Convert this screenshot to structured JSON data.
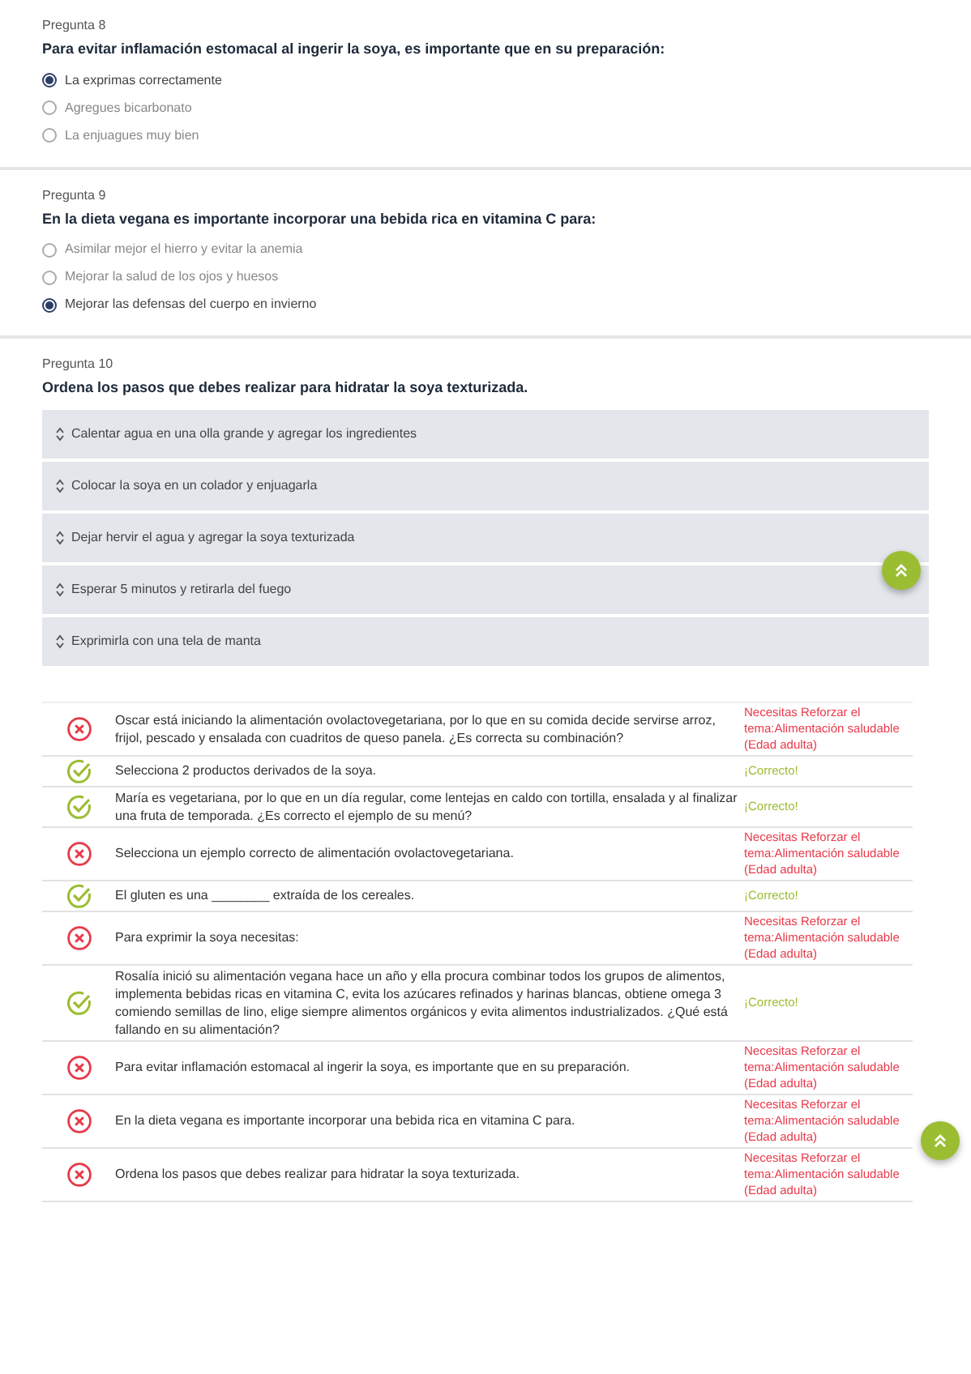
{
  "questions": [
    {
      "label": "Pregunta 8",
      "prompt": "Para evitar inflamación estomacal al ingerir la soya, es importante que en su preparación:",
      "kind": "radio",
      "options": [
        {
          "text": "La exprimas correctamente",
          "selected": true
        },
        {
          "text": "Agregues bicarbonato",
          "selected": false
        },
        {
          "text": "La enjuagues muy bien",
          "selected": false
        }
      ]
    },
    {
      "label": "Pregunta 9",
      "prompt": "En la dieta vegana es importante incorporar una bebida rica en vitamina C para:",
      "kind": "radio",
      "options": [
        {
          "text": "Asimilar mejor el hierro y evitar la anemia",
          "selected": false
        },
        {
          "text": "Mejorar la salud de los ojos y huesos",
          "selected": false
        },
        {
          "text": "Mejorar las defensas del cuerpo en invierno",
          "selected": true
        }
      ]
    },
    {
      "label": "Pregunta 10",
      "prompt": "Ordena los pasos que debes realizar para hidratar la soya texturizada.",
      "kind": "order",
      "options": [
        {
          "text": "Calentar agua en una olla grande y agregar los ingredientes"
        },
        {
          "text": "Colocar la soya en un colador y enjuagarla"
        },
        {
          "text": "Dejar hervir el agua y agregar la soya texturizada"
        },
        {
          "text": "Esperar 5 minutos y retirarla del fuego"
        },
        {
          "text": "Exprimirla con una tela de manta"
        }
      ]
    }
  ],
  "results": [
    {
      "correct": false,
      "question": "Oscar está iniciando la alimentación ovolactovegetariana, por lo que en su comida decide servirse arroz, frijol, pescado y ensalada con cuadritos de queso panela. ¿Es correcta su combinación?",
      "feedback": "Necesitas Reforzar el tema:Alimentación saludable (Edad adulta)"
    },
    {
      "correct": true,
      "question": "Selecciona 2 productos derivados de la soya.",
      "feedback": "¡Correcto!"
    },
    {
      "correct": true,
      "question": "María es vegetariana, por lo que en un día regular, come lentejas en caldo con tortilla, ensalada y al finalizar una fruta de temporada. ¿Es correcto el ejemplo de su menú?",
      "feedback": "¡Correcto!"
    },
    {
      "correct": false,
      "question": "Selecciona un ejemplo correcto de alimentación ovolactovegetariana.",
      "feedback": "Necesitas Reforzar el tema:Alimentación saludable (Edad adulta)"
    },
    {
      "correct": true,
      "question": "El gluten es una ________ extraída de los cereales.",
      "feedback": "¡Correcto!"
    },
    {
      "correct": false,
      "question": "Para exprimir la soya necesitas:",
      "feedback": "Necesitas Reforzar el tema:Alimentación saludable (Edad adulta)"
    },
    {
      "correct": true,
      "question": "Rosalía inició su alimentación vegana hace un año y ella procura combinar todos los grupos de alimentos, implementa bebidas ricas en vitamina C, evita los azúcares refinados y harinas blancas, obtiene omega 3 comiendo semillas de lino, elige siempre alimentos orgánicos y evita alimentos industrializados. ¿Qué está fallando en su alimentación?",
      "feedback": "¡Correcto!"
    },
    {
      "correct": false,
      "question": "Para evitar inflamación estomacal al ingerir la soya, es importante que en su preparación.",
      "feedback": "Necesitas Reforzar el tema:Alimentación saludable (Edad adulta)"
    },
    {
      "correct": false,
      "question": "En la dieta vegana es importante incorporar una bebida rica en vitamina C para.",
      "feedback": "Necesitas Reforzar el tema:Alimentación saludable (Edad adulta)"
    },
    {
      "correct": false,
      "question": "Ordena los pasos que debes realizar para hidratar la soya texturizada.",
      "feedback": "Necesitas Reforzar el tema:Alimentación saludable (Edad adulta)"
    }
  ]
}
